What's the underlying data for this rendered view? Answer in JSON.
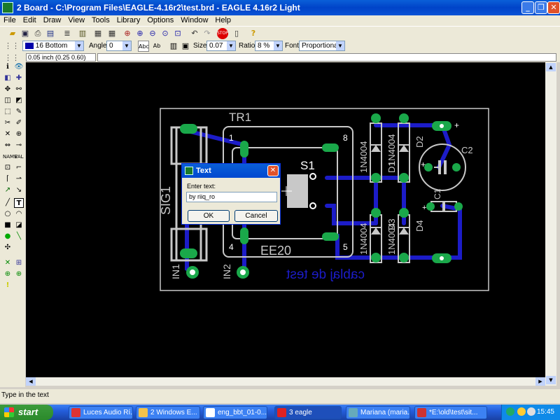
{
  "window": {
    "title": "2 Board - C:\\Program Files\\EAGLE-4.16r2\\test.brd - EAGLE 4.16r2 Light",
    "minimize_icon": "minimize-icon",
    "maximize_icon": "restore-icon",
    "close_icon": "close-icon"
  },
  "menu": [
    "File",
    "Edit",
    "Draw",
    "View",
    "Tools",
    "Library",
    "Options",
    "Window",
    "Help"
  ],
  "toolbar2": {
    "layer": "16 Bottom",
    "angle_label": "Angle:",
    "angle_value": "0",
    "size_label": "Size:",
    "size_value": "0.07",
    "ratio_label": "Ratio:",
    "ratio_value": "8 %",
    "font_label": "Font:",
    "font_value": "Proportional",
    "layer_color": "#0000aa"
  },
  "coordinates": "0.05 inch (0.25 0.60)",
  "board": {
    "labels": {
      "tr1": "TR1",
      "pin8": "8",
      "pin1": "1",
      "pin4": "4",
      "pin5": "5",
      "ee20": "EE20",
      "s1": "S1",
      "sig1": "SIG1",
      "in1": "IN1",
      "in2": "IN2",
      "d1": "1N4004",
      "d1_name": "D1",
      "d2": "1N4004",
      "d2_name": "D2",
      "d3": "1N4004",
      "d3_name": "D3",
      "d4": "1N4004",
      "d4_name": "D4",
      "c1": "C1",
      "c2": "C2",
      "plus1": "+",
      "plus2": "+",
      "plus3": "+",
      "mirrored_text": "cablaj de test"
    },
    "colors": {
      "background": "#000000",
      "silkscreen": "#c8c8c8",
      "bottom_trace": "#1c1cc8",
      "pad": "#1aa84a"
    }
  },
  "dialog": {
    "title": "Text",
    "prompt": "Enter text:",
    "value": "by riiq_ro",
    "ok": "OK",
    "cancel": "Cancel"
  },
  "status": "Type in the text",
  "taskbar": {
    "start": "start",
    "tasks": [
      {
        "label": "Luces Audio Rí...",
        "color": "#d33"
      },
      {
        "label": "2 Windows E...",
        "color": "#f3c34a"
      },
      {
        "label": "eng_bbt_01-0...",
        "color": "#fff"
      },
      {
        "label": "3 eagle",
        "color": "#d22"
      },
      {
        "label": "Mariana (maria...",
        "color": "#6ab"
      },
      {
        "label": "*E:\\old\\test\\sit...",
        "color": "#c33"
      }
    ],
    "clock": "15:45"
  }
}
